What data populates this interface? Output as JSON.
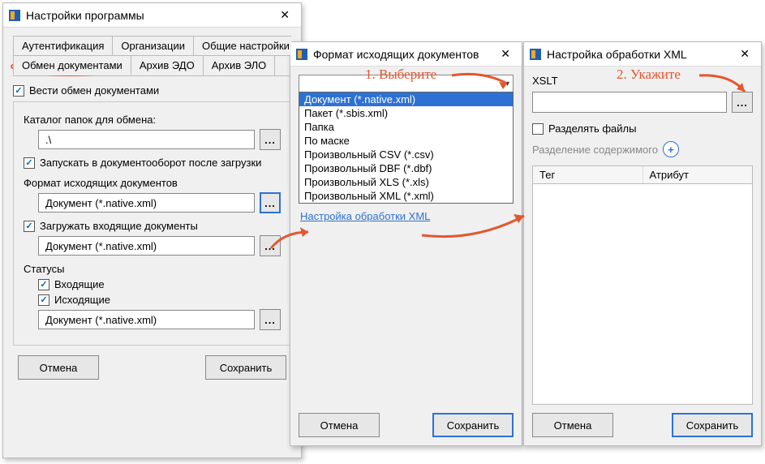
{
  "win1": {
    "title": "Настройки программы",
    "tabs_row1": [
      "Аутентификация",
      "Организации",
      "Общие настройки"
    ],
    "tabs_row2": [
      "Обмен документами",
      "Архив ЭДО",
      "Архив ЭЛО"
    ],
    "active_tab": "Обмен документами",
    "cb_exchange": "Вести обмен документами",
    "lbl_catalog": "Каталог папок для обмена:",
    "val_catalog": ".\\",
    "cb_run_after": "Запускать в документооборот после загрузки",
    "lbl_out_format": "Формат исходящих документов",
    "val_out_format": "Документ (*.native.xml)",
    "cb_load_incoming": "Загружать входящие документы",
    "val_incoming": "Документ (*.native.xml)",
    "lbl_statuses": "Статусы",
    "cb_incoming": "Входящие",
    "cb_outgoing": "Исходящие",
    "val_status": "Документ (*.native.xml)",
    "btn_cancel": "Отмена",
    "btn_save": "Сохранить"
  },
  "win2": {
    "title": "Формат исходящих документов",
    "options": [
      "Документ (*.native.xml)",
      "Пакет (*.sbis.xml)",
      "Папка",
      "По маске",
      "Произвольный CSV (*.csv)",
      "Произвольный DBF (*.dbf)",
      "Произвольный XLS (*.xls)",
      "Произвольный XML (*.xml)"
    ],
    "selected_index": 0,
    "link": "Настройка обработки XML",
    "btn_cancel": "Отмена",
    "btn_save": "Сохранить"
  },
  "win3": {
    "title": "Настройка обработки XML",
    "lbl_xslt": "XSLT",
    "cb_split": "Разделять файлы",
    "lbl_split_content": "Разделение содержимого",
    "col_tag": "Тег",
    "col_attr": "Атрибут",
    "btn_cancel": "Отмена",
    "btn_save": "Сохранить"
  },
  "annotations": {
    "step1": "1. Выберите",
    "step2": "2. Укажите"
  },
  "ellipsis": "..."
}
